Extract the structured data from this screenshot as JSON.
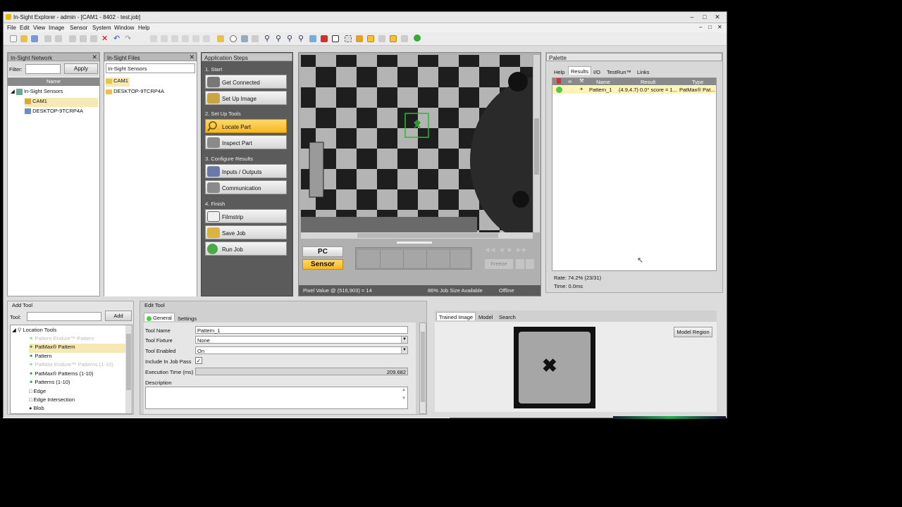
{
  "window": {
    "title": "In-Sight Explorer - admin - [CAM1 - 8402 - test.job]",
    "min": "–",
    "max": "□",
    "close": "✕"
  },
  "menu": [
    "File",
    "Edit",
    "View",
    "Image",
    "Sensor",
    "System",
    "Window",
    "Help"
  ],
  "network": {
    "title": "In-Sight Network",
    "filter_label": "Filter:",
    "apply_label": "Apply",
    "column_name": "Name",
    "tree": [
      "In-Sight Sensors",
      "CAM1",
      "DESKTOP-9TCRP4A"
    ]
  },
  "files": {
    "title": "In-Sight Files",
    "path": "In-Sight Sensors",
    "items": [
      "CAM1",
      "DESKTOP-9TCRP4A"
    ]
  },
  "steps": {
    "title": "Application Steps",
    "sections": [
      {
        "header": "1. Start",
        "buttons": [
          "Get Connected",
          "Set Up Image"
        ]
      },
      {
        "header": "2. Set Up Tools",
        "buttons": [
          "Locate Part",
          "Inspect Part"
        ]
      },
      {
        "header": "3. Configure Results",
        "buttons": [
          "Inputs / Outputs",
          "Communication"
        ]
      },
      {
        "header": "4. Finish",
        "buttons": [
          "Filmstrip",
          "Save Job",
          "Run Job"
        ]
      }
    ]
  },
  "image_view": {
    "pc_label": "PC",
    "sensor_label": "Sensor",
    "freeze_label": "Freeze",
    "status_pixel": "Pixel Value @ (516,903) = 14",
    "status_job": "86% Job Size Available",
    "status_mode": "Offline"
  },
  "palette": {
    "title": "Palette",
    "tabs": [
      "Help",
      "Results",
      "I/O",
      "TestRun™",
      "Links"
    ],
    "columns": [
      "Name",
      "Result",
      "Type"
    ],
    "row": {
      "name": "Pattern_1",
      "result": "(4.9,4.7) 0.0° score = 1...",
      "type": "PatMax® Pat..."
    },
    "rate": "Rate: 74.2% (23/31)",
    "time": "Time: 0.0ms"
  },
  "add_tool": {
    "title": "Add Tool",
    "tool_label": "Tool:",
    "add_label": "Add",
    "group": "Location Tools",
    "items": [
      {
        "label": "Pattern Endure™ Pattern",
        "disabled": true
      },
      {
        "label": "PatMax® Pattern",
        "disabled": false,
        "selected": true
      },
      {
        "label": "Pattern",
        "disabled": false
      },
      {
        "label": "PatMax Endure™ Patterns (1-10)",
        "disabled": true
      },
      {
        "label": "PatMax® Patterns (1-10)",
        "disabled": false
      },
      {
        "label": "Patterns (1-10)",
        "disabled": false
      },
      {
        "label": "Edge",
        "disabled": false
      },
      {
        "label": "Edge Intersection",
        "disabled": false
      },
      {
        "label": "Blob",
        "disabled": false
      }
    ]
  },
  "edit_tool": {
    "title": "Edit Tool",
    "tabs": [
      "General",
      "Settings"
    ],
    "tool_name_label": "Tool Name",
    "tool_name": "Pattern_1",
    "fixture_label": "Tool Fixture",
    "fixture": "None",
    "enabled_label": "Tool Enabled",
    "enabled": "On",
    "include_label": "Include In Job Pass",
    "include_checked": true,
    "exec_label": "Execution Time (ms)",
    "exec_value": "209.682",
    "desc_label": "Description",
    "desc_value": ""
  },
  "trained": {
    "tabs": [
      "Trained Image",
      "Model",
      "Search"
    ],
    "model_region_label": "Model Region"
  }
}
